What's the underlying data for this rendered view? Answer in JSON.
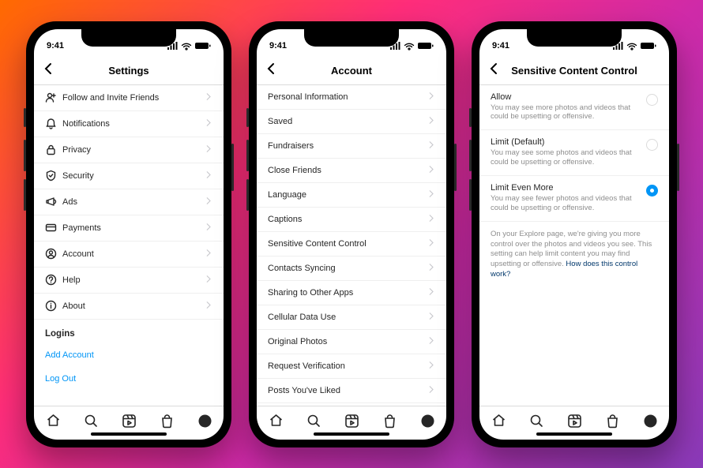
{
  "status": {
    "time": "9:41"
  },
  "phone1": {
    "title": "Settings",
    "items": [
      {
        "icon": "person-add",
        "label": "Follow and Invite Friends"
      },
      {
        "icon": "bell",
        "label": "Notifications"
      },
      {
        "icon": "lock",
        "label": "Privacy"
      },
      {
        "icon": "shield",
        "label": "Security"
      },
      {
        "icon": "megaphone",
        "label": "Ads"
      },
      {
        "icon": "card",
        "label": "Payments"
      },
      {
        "icon": "person-circle",
        "label": "Account"
      },
      {
        "icon": "help",
        "label": "Help"
      },
      {
        "icon": "info",
        "label": "About"
      }
    ],
    "logins_header": "Logins",
    "add_account": "Add Account",
    "log_out": "Log Out"
  },
  "phone2": {
    "title": "Account",
    "items": [
      "Personal Information",
      "Saved",
      "Fundraisers",
      "Close Friends",
      "Language",
      "Captions",
      "Sensitive Content Control",
      "Contacts Syncing",
      "Sharing to Other Apps",
      "Cellular Data Use",
      "Original Photos",
      "Request Verification",
      "Posts You've Liked"
    ]
  },
  "phone3": {
    "title": "Sensitive Content Control",
    "options": [
      {
        "title": "Allow",
        "desc": "You may see more photos and videos that could be upsetting or offensive.",
        "selected": false
      },
      {
        "title": "Limit (Default)",
        "desc": "You may see some photos and videos that could be upsetting or offensive.",
        "selected": false
      },
      {
        "title": "Limit Even More",
        "desc": "You may see fewer photos and videos that could be upsetting or offensive.",
        "selected": true
      }
    ],
    "footer_text": "On your Explore page, we're giving you more control over the photos and videos you see. This setting can help limit content you may find upsetting or offensive. ",
    "footer_link": "How does this control work?"
  }
}
